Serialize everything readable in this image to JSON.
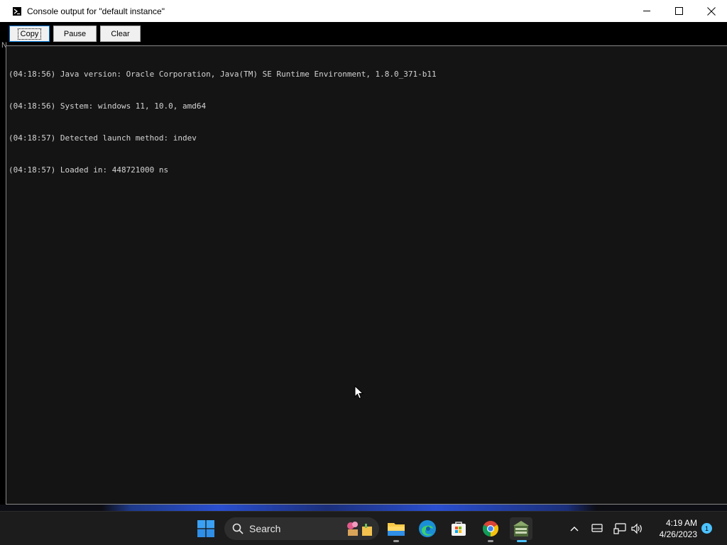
{
  "window": {
    "title": "Console output for \"default instance\"",
    "icon": "terminal-icon",
    "controls": [
      "minimize-icon",
      "maximize-icon",
      "close-icon"
    ]
  },
  "toolbar": {
    "copy_label": "Copy",
    "pause_label": "Pause",
    "clear_label": "Clear",
    "stray_glyph": "N"
  },
  "console": {
    "lines": [
      "(04:18:56) Java version: Oracle Corporation, Java(TM) SE Runtime Environment, 1.8.0_371-b11",
      "(04:18:56) System: windows 11, 10.0, amd64",
      "(04:18:57) Detected launch method: indev",
      "(04:18:57) Loaded in: 448721000 ns"
    ]
  },
  "taskbar": {
    "start_icon": "windows-start-icon",
    "search_placeholder": "Search",
    "pinned": [
      {
        "name": "file-explorer-icon",
        "running": true
      },
      {
        "name": "edge-browser-icon",
        "running": false
      },
      {
        "name": "microsoft-store-icon",
        "running": false
      },
      {
        "name": "chrome-icon",
        "running": true
      },
      {
        "name": "game-app-icon",
        "running": true,
        "active": true
      }
    ],
    "tray": [
      "chevron-up-icon",
      "display-icon",
      "network-icon",
      "volume-icon"
    ],
    "time": "4:19 AM",
    "date": "4/26/2023",
    "notification_count": "1"
  },
  "colors": {
    "accent": "#4cc2ff",
    "console_bg": "#141414",
    "console_text": "#d4d4d4",
    "taskbar_bg": "#1c1c1c"
  }
}
